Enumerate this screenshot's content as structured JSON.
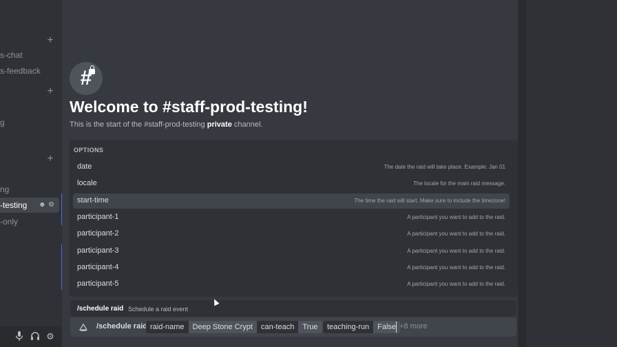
{
  "sidebar": {
    "channels": [
      {
        "label": "s-chat"
      },
      {
        "label": "s-feedback"
      },
      {
        "label": "g"
      },
      {
        "label": "ng"
      },
      {
        "label": "-testing"
      },
      {
        "label": "-only"
      }
    ]
  },
  "welcome": {
    "title": "Welcome to #staff-prod-testing!",
    "subtitle_prefix": "This is the start of the #staff-prod-testing ",
    "subtitle_bold": "private",
    "subtitle_suffix": " channel."
  },
  "options": {
    "header": "OPTIONS",
    "items": [
      {
        "name": "date",
        "desc": "The date the raid will take place. Example: Jan 01"
      },
      {
        "name": "locale",
        "desc": "The locale for the main raid message."
      },
      {
        "name": "start-time",
        "desc": "The time the raid will start. Make sure to include the timezone!"
      },
      {
        "name": "participant-1",
        "desc": "A participant you want to add to the raid."
      },
      {
        "name": "participant-2",
        "desc": "A participant you want to add to the raid."
      },
      {
        "name": "participant-3",
        "desc": "A participant you want to add to the raid."
      },
      {
        "name": "participant-4",
        "desc": "A participant you want to add to the raid."
      },
      {
        "name": "participant-5",
        "desc": "A participant you want to add to the raid."
      }
    ]
  },
  "command": {
    "name": "/schedule raid",
    "desc": "Schedule a raid event"
  },
  "input": {
    "command": "/schedule raid",
    "chips": [
      {
        "key": "raid-name",
        "value": "Deep Stone Crypt"
      },
      {
        "key": "can-teach",
        "value": "True"
      },
      {
        "key": "teaching-run",
        "value": "False"
      }
    ],
    "more": "+8 more"
  },
  "colors": {
    "accent": "#5865f2",
    "background": "#36393f",
    "sidebar": "#2f3136"
  }
}
